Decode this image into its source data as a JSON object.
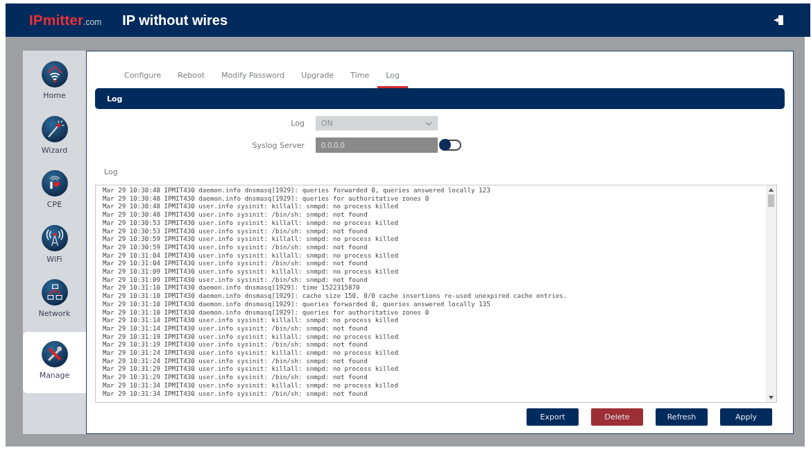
{
  "header": {
    "logo_brand": "IPmitter",
    "logo_suffix": ".com",
    "tagline": "IP without wires"
  },
  "sidebar": {
    "items": [
      {
        "label": "Home",
        "selected": false
      },
      {
        "label": "Wizard",
        "selected": false
      },
      {
        "label": "CPE",
        "selected": false
      },
      {
        "label": "WiFi",
        "selected": false
      },
      {
        "label": "Network",
        "selected": false
      },
      {
        "label": "Manage",
        "selected": true
      }
    ]
  },
  "tabs": [
    {
      "label": "Configure",
      "selected": false
    },
    {
      "label": "Reboot",
      "selected": false
    },
    {
      "label": "Modify Password",
      "selected": false
    },
    {
      "label": "Upgrade",
      "selected": false
    },
    {
      "label": "Time",
      "selected": false
    },
    {
      "label": "Log",
      "selected": true
    }
  ],
  "section_title": "Log",
  "form": {
    "log_label": "Log",
    "log_value": "ON",
    "syslog_label": "Syslog Server",
    "syslog_placeholder": "0.0.0.0",
    "syslog_enabled": false
  },
  "log_label": "Log",
  "log_lines": [
    "Mar 29 10:30:48 IPMIT430 daemon.info dnsmasq[1929]: queries forwarded 0, queries answered locally 123",
    "Mar 29 10:30:48 IPMIT430 daemon.info dnsmasq[1929]: queries for authoritative zones 0",
    "Mar 29 10:30:48 IPMIT430 user.info sysinit: killall: snmpd: no process killed",
    "Mar 29 10:30:48 IPMIT430 user.info sysinit: /bin/sh: snmpd: not found",
    "Mar 29 10:30:53 IPMIT430 user.info sysinit: killall: snmpd: no process killed",
    "Mar 29 10:30:53 IPMIT430 user.info sysinit: /bin/sh: snmpd: not found",
    "Mar 29 10:30:59 IPMIT430 user.info sysinit: killall: snmpd: no process killed",
    "Mar 29 10:30:59 IPMIT430 user.info sysinit: /bin/sh: snmpd: not found",
    "Mar 29 10:31:04 IPMIT430 user.info sysinit: killall: snmpd: no process killed",
    "Mar 29 10:31:04 IPMIT430 user.info sysinit: /bin/sh: snmpd: not found",
    "Mar 29 10:31:09 IPMIT430 user.info sysinit: killall: snmpd: no process killed",
    "Mar 29 10:31:09 IPMIT430 user.info sysinit: /bin/sh: snmpd: not found",
    "Mar 29 10:31:10 IPMIT430 daemon.info dnsmasq[1929]: time 1522315870",
    "Mar 29 10:31:10 IPMIT430 daemon.info dnsmasq[1929]: cache size 150, 0/0 cache insertions re-used unexpired cache entries.",
    "Mar 29 10:31:10 IPMIT430 daemon.info dnsmasq[1929]: queries forwarded 0, queries answered locally 135",
    "Mar 29 10:31:10 IPMIT430 daemon.info dnsmasq[1929]: queries for authoritative zones 0",
    "Mar 29 10:31:14 IPMIT430 user.info sysinit: killall: snmpd: no process killed",
    "Mar 29 10:31:14 IPMIT430 user.info sysinit: /bin/sh: snmpd: not found",
    "Mar 29 10:31:19 IPMIT430 user.info sysinit: killall: snmpd: no process killed",
    "Mar 29 10:31:19 IPMIT430 user.info sysinit: /bin/sh: snmpd: not found",
    "Mar 29 10:31:24 IPMIT430 user.info sysinit: killall: snmpd: no process killed",
    "Mar 29 10:31:24 IPMIT430 user.info sysinit: /bin/sh: snmpd: not found",
    "Mar 29 10:31:29 IPMIT430 user.info sysinit: killall: snmpd: no process killed",
    "Mar 29 10:31:29 IPMIT430 user.info sysinit: /bin/sh: snmpd: not found",
    "Mar 29 10:31:34 IPMIT430 user.info sysinit: killall: snmpd: no process killed",
    "Mar 29 10:31:34 IPMIT430 user.info sysinit: /bin/sh: snmpd: not found"
  ],
  "buttons": [
    {
      "label": "Export",
      "kind": "primary"
    },
    {
      "label": "Delete",
      "kind": "danger"
    },
    {
      "label": "Refresh",
      "kind": "primary"
    },
    {
      "label": "Apply",
      "kind": "primary"
    }
  ]
}
